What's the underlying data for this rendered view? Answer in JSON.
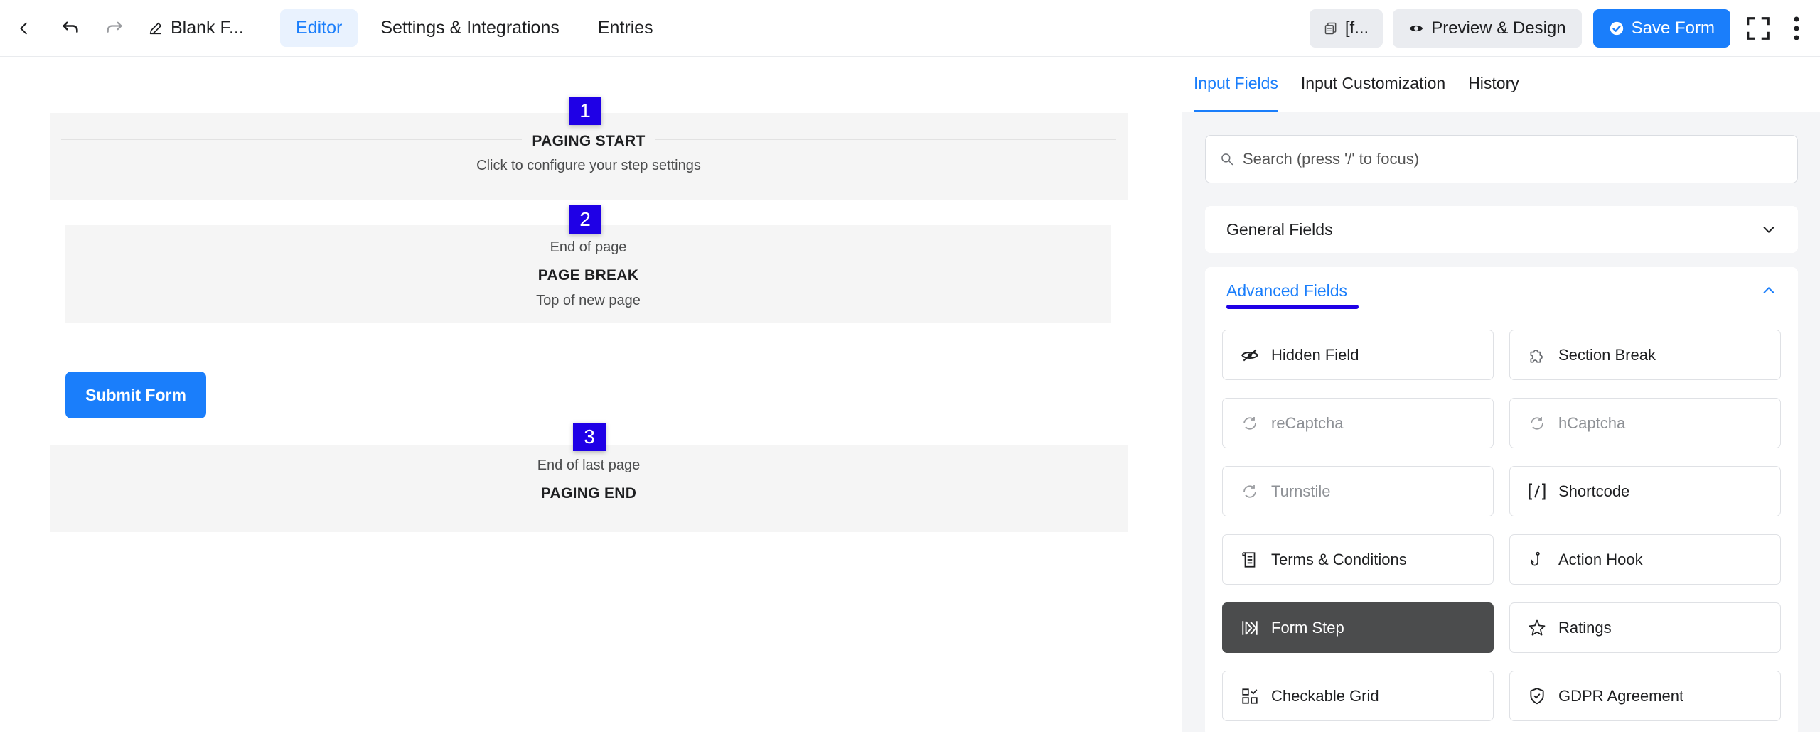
{
  "topbar": {
    "form_title": "Blank F...",
    "tabs": [
      {
        "label": "Editor",
        "active": true
      },
      {
        "label": "Settings & Integrations",
        "active": false
      },
      {
        "label": "Entries",
        "active": false
      }
    ],
    "shortcode_label": "[f...",
    "preview_label": "Preview & Design",
    "save_label": "Save Form"
  },
  "editor": {
    "paging_start": {
      "badge": "1",
      "title": "PAGING START",
      "subtitle": "Click to configure your step settings"
    },
    "page_break": {
      "badge": "2",
      "top_text": "End of page",
      "title": "PAGE BREAK",
      "bottom_text": "Top of new page"
    },
    "submit_label": "Submit Form",
    "paging_end": {
      "badge": "3",
      "top_text": "End of last page",
      "title": "PAGING END"
    }
  },
  "panel": {
    "tabs": [
      {
        "label": "Input Fields",
        "active": true
      },
      {
        "label": "Input Customization",
        "active": false
      },
      {
        "label": "History",
        "active": false
      }
    ],
    "search_placeholder": "Search (press '/' to focus)",
    "general_fields": "General Fields",
    "advanced_fields": "Advanced Fields",
    "fields": [
      {
        "label": "Hidden Field",
        "icon": "eye-slash-icon",
        "state": "normal"
      },
      {
        "label": "Section Break",
        "icon": "puzzle-icon",
        "state": "normal"
      },
      {
        "label": "reCaptcha",
        "icon": "recaptcha-icon",
        "state": "disabled"
      },
      {
        "label": "hCaptcha",
        "icon": "hcaptcha-icon",
        "state": "disabled"
      },
      {
        "label": "Turnstile",
        "icon": "turnstile-icon",
        "state": "disabled"
      },
      {
        "label": "Shortcode",
        "icon": "shortcode-icon",
        "state": "normal"
      },
      {
        "label": "Terms & Conditions",
        "icon": "scroll-icon",
        "state": "normal"
      },
      {
        "label": "Action Hook",
        "icon": "hook-icon",
        "state": "normal"
      },
      {
        "label": "Form Step",
        "icon": "form-step-icon",
        "state": "selected"
      },
      {
        "label": "Ratings",
        "icon": "star-icon",
        "state": "normal"
      },
      {
        "label": "Checkable Grid",
        "icon": "checkable-grid-icon",
        "state": "normal"
      },
      {
        "label": "GDPR Agreement",
        "icon": "shield-check-icon",
        "state": "normal"
      }
    ]
  },
  "colors": {
    "accent": "#1a7efb",
    "badge": "#1f00e6",
    "selected": "#4b4c4d"
  }
}
